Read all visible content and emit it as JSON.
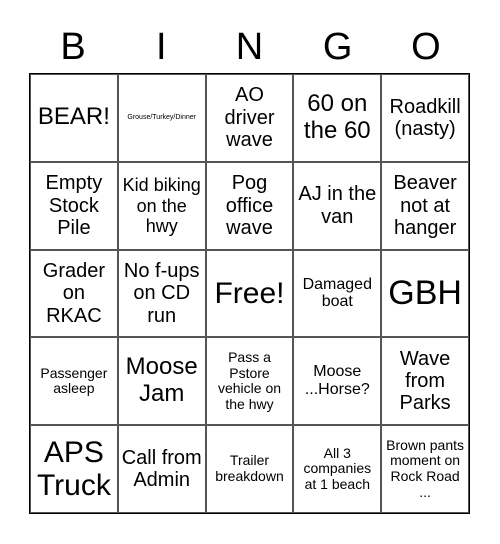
{
  "header": [
    "B",
    "I",
    "N",
    "G",
    "O"
  ],
  "cells": [
    "BEAR!",
    "Grouse/Turkey/Dinner",
    "AO driver wave",
    "60 on the 60",
    "Roadkill (nasty)",
    "Empty Stock Pile",
    "Kid biking on the hwy",
    "Pog office wave",
    "AJ in the van",
    "Beaver not at hanger",
    "Grader on RKAC",
    "No f-ups on CD run",
    "Free!",
    "Damaged boat",
    "GBH",
    "Passenger asleep",
    "Moose Jam",
    "Pass a Pstore vehicle on the hwy",
    "Moose ...Horse?",
    "Wave from Parks",
    "APS Truck",
    "Call from Admin",
    "Trailer breakdown",
    "All 3 companies at 1 beach",
    "Brown pants moment on Rock Road ..."
  ]
}
